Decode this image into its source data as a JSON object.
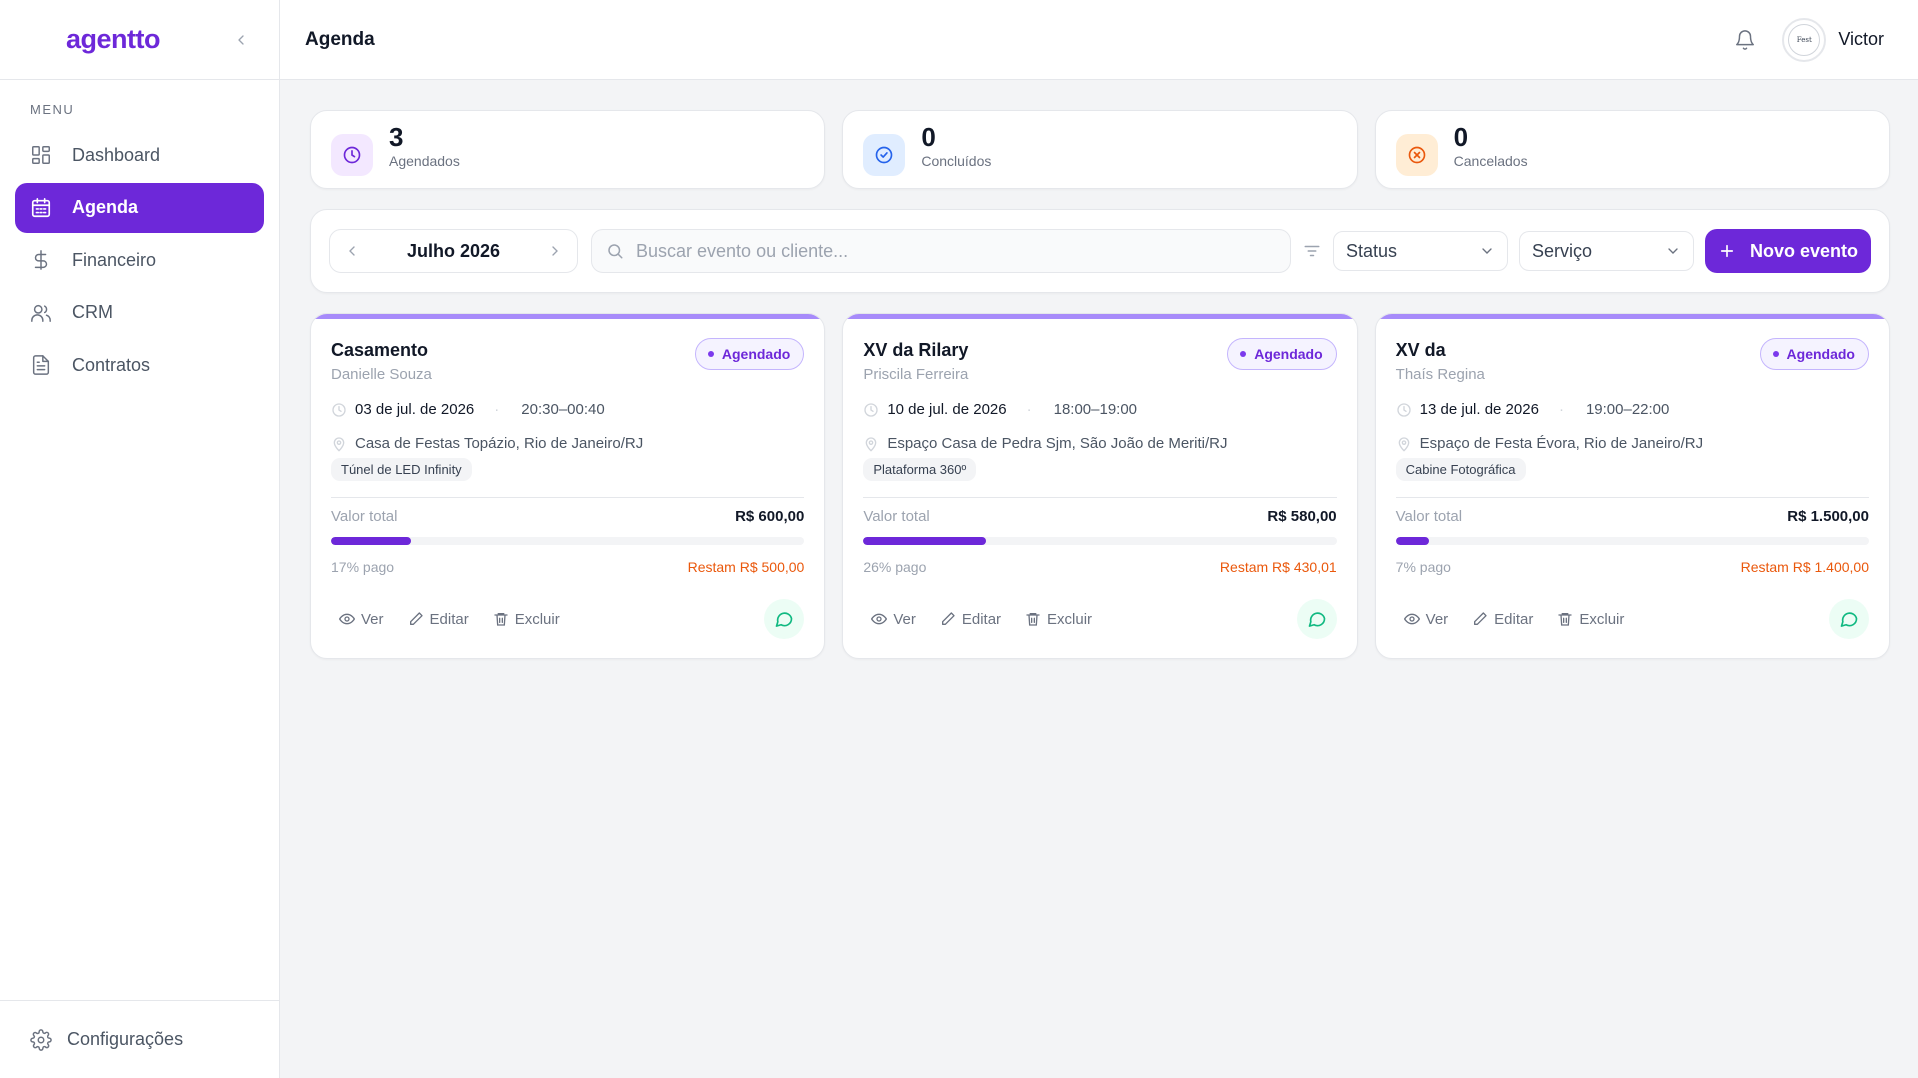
{
  "brand": {
    "logo": "agentto"
  },
  "sidebar": {
    "menu_label": "MENU",
    "items": [
      {
        "label": "Dashboard",
        "icon": "grid-icon",
        "active": false
      },
      {
        "label": "Agenda",
        "icon": "calendar-icon",
        "active": true
      },
      {
        "label": "Financeiro",
        "icon": "dollar-icon",
        "active": false
      },
      {
        "label": "CRM",
        "icon": "users-icon",
        "active": false
      },
      {
        "label": "Contratos",
        "icon": "file-icon",
        "active": false
      }
    ],
    "footer_label": "Configurações"
  },
  "header": {
    "title": "Agenda",
    "user_name": "Victor",
    "avatar_text": "Fest"
  },
  "stats": [
    {
      "value": "3",
      "label": "Agendados",
      "color": "#6d28d9"
    },
    {
      "value": "0",
      "label": "Concluídos",
      "color": "#2563eb"
    },
    {
      "value": "0",
      "label": "Cancelados",
      "color": "#ea580c"
    }
  ],
  "toolbar": {
    "month": "Julho 2026",
    "search_placeholder": "Buscar evento ou cliente...",
    "status_select": "Status",
    "service_select": "Serviço",
    "new_event_label": "Novo evento"
  },
  "events": [
    {
      "title": "Casamento",
      "client": "Danielle Souza",
      "status": "Agendado",
      "date": "03 de jul. de 2026",
      "time": "20:30–00:40",
      "location": "Casa de Festas Topázio, Rio de Janeiro/RJ",
      "service": "Túnel de LED Infinity",
      "total_label": "Valor total",
      "total": "R$ 600,00",
      "paid_fraction": 0.17,
      "paid_text": "17% pago",
      "remaining": "Restam R$ 500,00",
      "actions": {
        "view": "Ver",
        "edit": "Editar",
        "delete": "Excluir"
      }
    },
    {
      "title": "XV da Rilary",
      "client": "Priscila Ferreira",
      "status": "Agendado",
      "date": "10 de jul. de 2026",
      "time": "18:00–19:00",
      "location": "Espaço Casa de Pedra Sjm, São João de Meriti/RJ",
      "service": "Plataforma 360º",
      "total_label": "Valor total",
      "total": "R$ 580,00",
      "paid_fraction": 0.26,
      "paid_text": "26% pago",
      "remaining": "Restam R$ 430,01",
      "actions": {
        "view": "Ver",
        "edit": "Editar",
        "delete": "Excluir"
      }
    },
    {
      "title": "XV da",
      "client": "Thaís Regina",
      "status": "Agendado",
      "date": "13 de jul. de 2026",
      "time": "19:00–22:00",
      "location": "Espaço de Festa Évora, Rio de Janeiro/RJ",
      "service": "Cabine Fotográfica",
      "total_label": "Valor total",
      "total": "R$ 1.500,00",
      "paid_fraction": 0.07,
      "paid_text": "7% pago",
      "remaining": "Restam R$ 1.400,00",
      "actions": {
        "view": "Ver",
        "edit": "Editar",
        "delete": "Excluir"
      }
    }
  ]
}
